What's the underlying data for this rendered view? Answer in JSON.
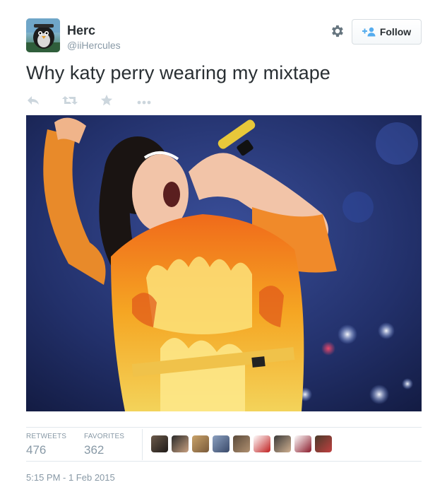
{
  "user": {
    "name": "Herc",
    "handle": "@iiHercules",
    "avatar_icon": "penguin-avatar"
  },
  "header": {
    "settings_icon": "gear-icon",
    "follow_label": "Follow",
    "follow_icon": "add-user-icon"
  },
  "tweet": {
    "text": "Why katy perry wearing my mixtape"
  },
  "actions": [
    {
      "icon": "reply-icon"
    },
    {
      "icon": "retweet-icon"
    },
    {
      "icon": "star-icon"
    },
    {
      "icon": "more-icon"
    }
  ],
  "stats": {
    "retweets_label": "RETWEETS",
    "retweets": "476",
    "favorites_label": "FAVORITES",
    "favorites": "362"
  },
  "favoriters_count_shown": 9,
  "timestamp": "5:15 PM - 1 Feb 2015",
  "colors": {
    "text": "#292f33",
    "muted": "#8899a6",
    "border": "#e1e8ed",
    "follow_icon_blue": "#55acee"
  }
}
